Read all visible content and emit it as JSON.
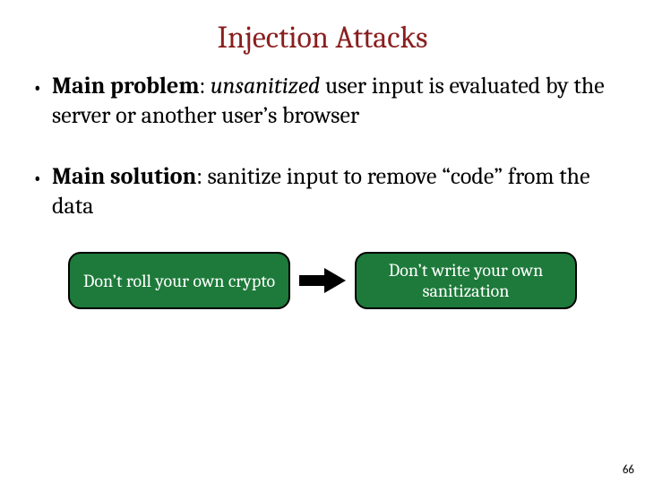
{
  "title": "Injection Attacks",
  "bullets": [
    {
      "label": "Main problem",
      "sep": ": ",
      "emph": "unsanitized",
      "rest": " user input is evaluated by the server or another user’s browser"
    },
    {
      "label": "Main solution",
      "sep": ": ",
      "emph": "",
      "rest": "sanitize input to remove “code” from the data"
    }
  ],
  "pill_left": "Don’t roll your own crypto",
  "pill_right": "Don’t write your own sanitization",
  "page_number": "66",
  "colors": {
    "title": "#8a1f1f",
    "pill_bg": "#1d7a3a"
  }
}
